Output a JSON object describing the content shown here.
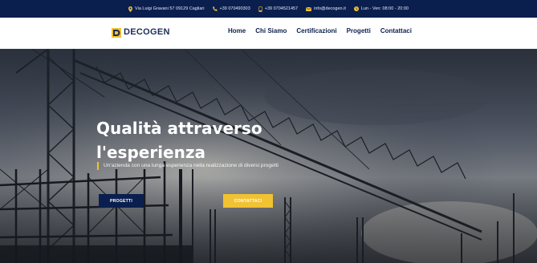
{
  "topbar": {
    "address": "Via Luigi Gravani 57 09129 Cagliari",
    "phone1": "+39 070490303",
    "phone2": "+39 0704521457",
    "email": "info@decogen.it",
    "hours": "Lun - Ven: 08:00 - 20:00",
    "icons": [
      "location-pin-icon",
      "phone-icon",
      "mobile-icon",
      "mail-icon",
      "clock-icon"
    ]
  },
  "brand": {
    "name": "DECOGEN",
    "colors": {
      "navy": "#0b1f4f",
      "yellow": "#f1c232"
    }
  },
  "nav": {
    "items": [
      "Home",
      "Chi Siamo",
      "Certificazioni",
      "Progetti",
      "Contattaci"
    ]
  },
  "hero": {
    "title_line1": "Qualità attraverso",
    "title_line2": "l'esperienza",
    "subtitle": "Un'azienda con una lunga esperienza nella realizzazione di diversi progetti",
    "primary_button": "PROGETTI",
    "secondary_button": "CONTATTACI"
  }
}
